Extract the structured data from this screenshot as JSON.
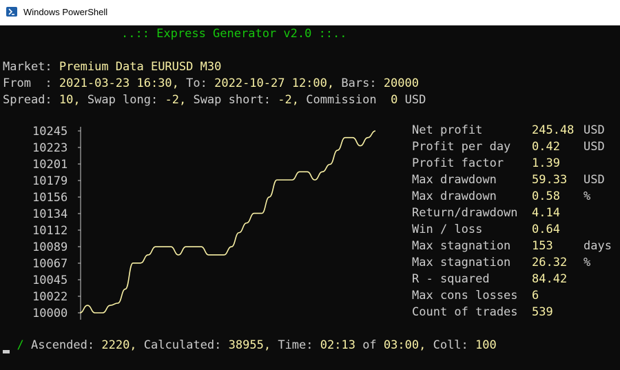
{
  "window": {
    "title": "Windows PowerShell"
  },
  "header": "..:: Express Generator v2.0 ::..",
  "market": {
    "label": "Market:",
    "value": "Premium Data EURUSD M30"
  },
  "period": {
    "from_label": "From  :",
    "from_value": "2021-03-23 16:30,",
    "to_label": "To:",
    "to_value": "2022-10-27 12:00,",
    "bars_label": "Bars:",
    "bars_value": "20000"
  },
  "costs": {
    "spread_label": "Spread:",
    "spread_value": "10,",
    "swap_long_label": "Swap long:",
    "swap_long_value": "-2,",
    "swap_short_label": "Swap short:",
    "swap_short_value": "-2,",
    "commission_label": "Commission",
    "commission_value": "0",
    "commission_unit": "USD"
  },
  "stats": [
    {
      "label": "Net profit",
      "value": "245.48",
      "unit": "USD"
    },
    {
      "label": "Profit per day",
      "value": "0.42",
      "unit": "USD"
    },
    {
      "label": "Profit factor",
      "value": "1.39",
      "unit": ""
    },
    {
      "label": "Max drawdown",
      "value": "59.33",
      "unit": "USD"
    },
    {
      "label": "Max drawdown",
      "value": "0.58",
      "unit": "%"
    },
    {
      "label": "Return/drawdown",
      "value": "4.14",
      "unit": ""
    },
    {
      "label": "Win / loss",
      "value": "0.64",
      "unit": ""
    },
    {
      "label": "Max stagnation",
      "value": "153",
      "unit": "days"
    },
    {
      "label": "Max stagnation",
      "value": "26.32",
      "unit": "%"
    },
    {
      "label": "R - squared",
      "value": "84.42",
      "unit": ""
    },
    {
      "label": "Max cons losses",
      "value": "6",
      "unit": ""
    },
    {
      "label": "Count of trades",
      "value": "539",
      "unit": ""
    }
  ],
  "status": {
    "spinner": "/",
    "ascended_label": "Ascended:",
    "ascended_value": "2220,",
    "calculated_label": "Calculated:",
    "calculated_value": "38955,",
    "time_label": "Time:",
    "time_value": "02:13",
    "of_label": "of",
    "time_limit": "03:00,",
    "coll_label": "Coll:",
    "coll_value": "100"
  },
  "colors": {
    "background": "#0c0c0c",
    "text": "#cccccc",
    "value": "#f9f1a5",
    "accent": "#16c60c",
    "titlebar": "#ffffff"
  },
  "chart_data": {
    "type": "line",
    "title": "",
    "xlabel": "",
    "ylabel": "",
    "y_ticks": [
      "10245",
      "10223",
      "10201",
      "10179",
      "10156",
      "10134",
      "10112",
      "10089",
      "10067",
      "10045",
      "10022",
      "10000"
    ],
    "ylim": [
      10000,
      10245
    ],
    "grid": false,
    "series": [
      {
        "values": [
          10000,
          10010,
          10000,
          10000,
          10010,
          10013,
          10032,
          10067,
          10067,
          10078,
          10089,
          10089,
          10089,
          10078,
          10089,
          10089,
          10089,
          10078,
          10078,
          10078,
          10089,
          10108,
          10121,
          10134,
          10134,
          10156,
          10179,
          10179,
          10179,
          10190,
          10190,
          10179,
          10190,
          10200,
          10219,
          10236,
          10236,
          10225,
          10236,
          10245
        ]
      }
    ]
  }
}
